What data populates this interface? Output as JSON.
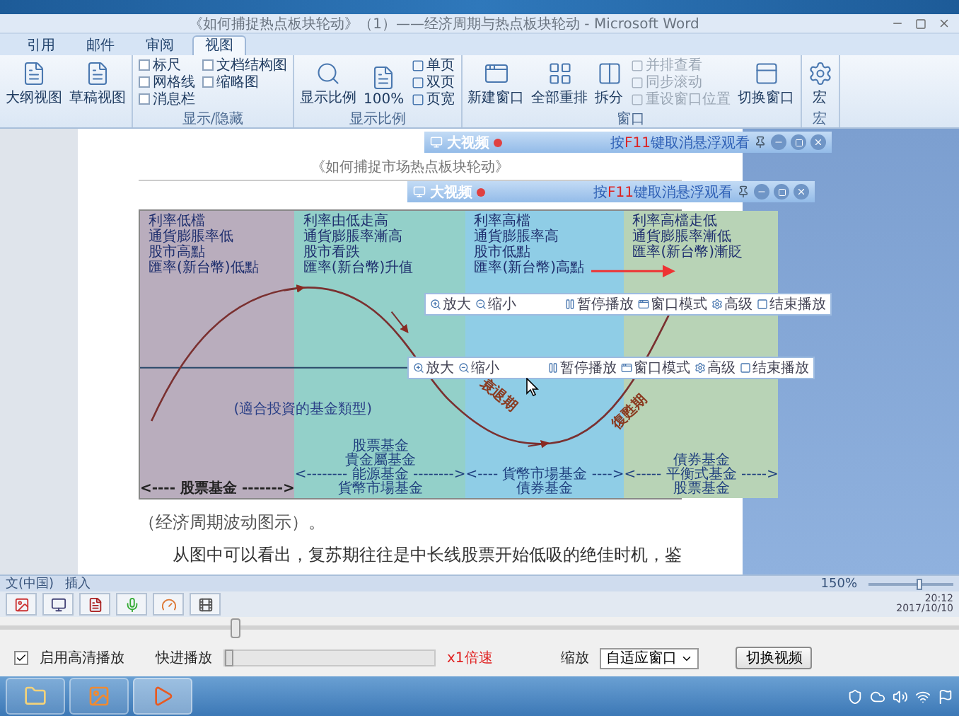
{
  "window": {
    "title": "《如何捕捉热点板块轮动》（1）——经济周期与热点板块轮动 - Microsoft Word"
  },
  "ribbon": {
    "tabs": [
      {
        "label": "引用",
        "selected": false
      },
      {
        "label": "邮件",
        "selected": false
      },
      {
        "label": "审阅",
        "selected": false
      },
      {
        "label": "视图",
        "selected": true
      }
    ],
    "groups": [
      {
        "items": [
          {
            "kind": "large",
            "label": "大纲视图",
            "disabled": false
          },
          {
            "kind": "large",
            "label": "草稿视图",
            "disabled": false
          }
        ]
      },
      {
        "label": "显示/隐藏",
        "items": [
          {
            "kind": "check",
            "label": "标尺",
            "checked": false
          },
          {
            "kind": "check",
            "label": "网格线",
            "checked": false
          },
          {
            "kind": "check",
            "label": "消息栏",
            "checked": false
          },
          {
            "kind": "check",
            "label": "文档结构图",
            "checked": false
          },
          {
            "kind": "check",
            "label": "缩略图",
            "checked": false
          }
        ]
      },
      {
        "label": "显示比例",
        "items": [
          {
            "kind": "large",
            "label": "显示比例",
            "disabled": false
          },
          {
            "kind": "large",
            "label": "100%",
            "disabled": false
          },
          {
            "kind": "small",
            "label": "单页",
            "disabled": false
          },
          {
            "kind": "small",
            "label": "双页",
            "disabled": false
          },
          {
            "kind": "small",
            "label": "页宽",
            "disabled": false
          }
        ]
      },
      {
        "label": "窗口",
        "items": [
          {
            "kind": "large",
            "label": "新建窗口",
            "disabled": false
          },
          {
            "kind": "large",
            "label": "全部重排",
            "disabled": false
          },
          {
            "kind": "large",
            "label": "拆分",
            "disabled": false
          },
          {
            "kind": "small",
            "label": "并排查看",
            "disabled": true
          },
          {
            "kind": "small",
            "label": "同步滚动",
            "disabled": true
          },
          {
            "kind": "small",
            "label": "重设窗口位置",
            "disabled": true
          },
          {
            "kind": "large",
            "label": "切换窗口",
            "disabled": false
          }
        ]
      },
      {
        "label": "宏",
        "items": [
          {
            "kind": "large",
            "label": "宏",
            "disabled": false
          }
        ]
      }
    ]
  },
  "document": {
    "header": "《如何捕捉市场热点板块轮动》",
    "figure": {
      "columns": [
        {
          "color": "#b9adbd",
          "conditions": [
            "利率低檔",
            "通貨膨脹率低",
            "股市高點",
            "匯率(新台幣)低點"
          ],
          "funds": [
            "<----  股票基金  ------->"
          ]
        },
        {
          "color": "#93d0c9",
          "conditions": [
            "利率由低走高",
            "通貨膨脹率漸高",
            "股市看跌",
            "匯率(新台幣)升值"
          ],
          "funds": [
            "股票基金",
            "貴金屬基金",
            "<-------- 能源基金 -------->",
            "貨幣市場基金"
          ]
        },
        {
          "color": "#8fcde6",
          "conditions": [
            "利率高檔",
            "通貨膨脹率高",
            "股市低點",
            "匯率(新台幣)高點"
          ],
          "funds": [
            "<---- 貨幣市場基金 ---->",
            "債券基金"
          ]
        },
        {
          "color": "#b8d3b6",
          "conditions": [
            "利率高檔走低",
            "通貨膨脹率漸低",
            "匯率(新台幣)漸貶"
          ],
          "funds": [
            "債券基金",
            "<----- 平衡式基金 ----->",
            "股票基金"
          ]
        }
      ],
      "fund_heading": "(適合投資的基金類型)",
      "phases": [
        "衰退期",
        "復甦期"
      ]
    },
    "caption": "（经济周期波动图示）。",
    "paragraph": "从图中可以看出，复苏期往往是中长线股票开始低吸的绝佳时机，鉴"
  },
  "video_windows": [
    {
      "title": "大视频",
      "hint_before": "按",
      "hint_key": "F11",
      "hint_after": "键取消悬浮观看",
      "toolbar": [
        "放大",
        "缩小",
        "暂停播放",
        "窗口模式",
        "高级",
        "结束播放"
      ]
    },
    {
      "title": "大视频",
      "hint_before": "按",
      "hint_key": "F11",
      "hint_after": "键取消悬浮观看",
      "toolbar": [
        "放大",
        "缩小",
        "暂停播放",
        "窗口模式",
        "高级",
        "结束播放"
      ]
    }
  ],
  "status_bar": {
    "language": "文(中国)",
    "mode": "插入",
    "zoom": "150%",
    "zoom_slider": {
      "level": 0.6
    }
  },
  "tray": {
    "time": "20:12",
    "date": "2017/10/10"
  },
  "player": {
    "progress": {
      "level": 0.245
    },
    "hd": {
      "label": "启用高清播放",
      "checked": true
    },
    "speed": {
      "label": "快进播放",
      "level": 0,
      "reading": "x1倍速"
    },
    "zoom": {
      "label": "缩放",
      "value": "自适应窗口"
    },
    "switch_button": "切换视频"
  }
}
